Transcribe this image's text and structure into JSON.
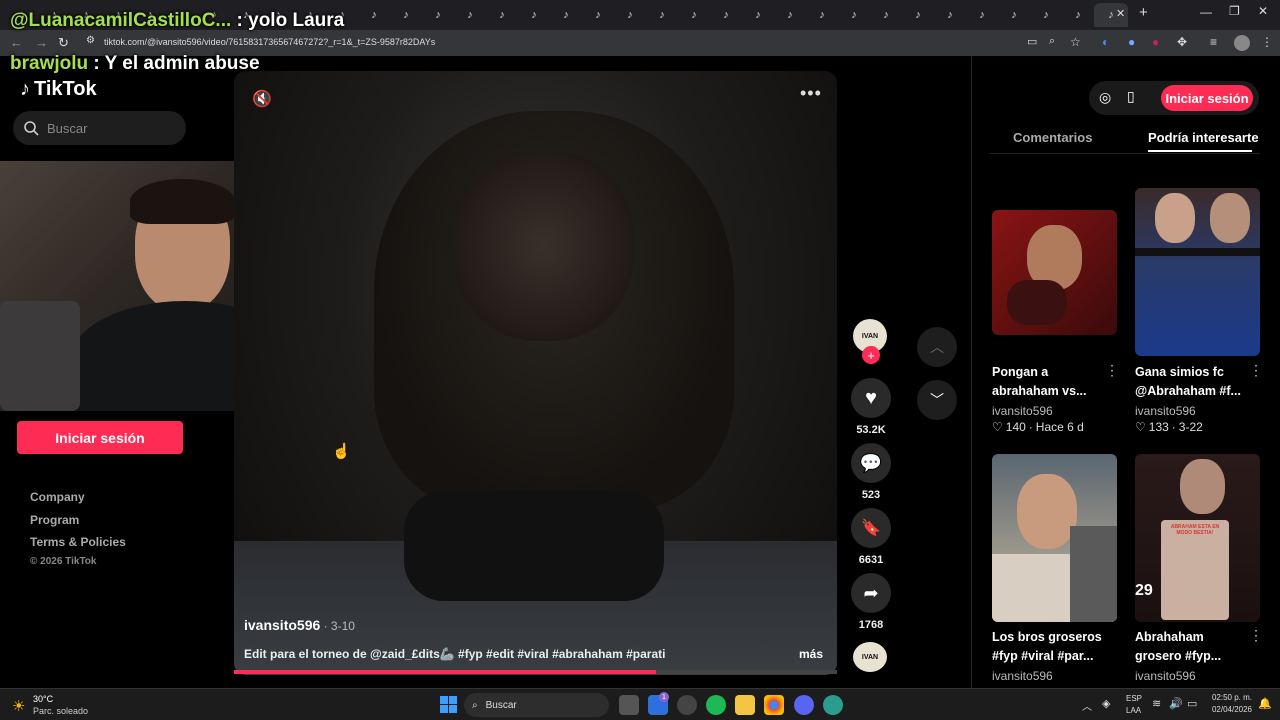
{
  "browser": {
    "url": "tiktok.com/@ivansito596/video/7615831736567467272?_r=1&_t=ZS-9587r82DAYs",
    "tab_close": "✕",
    "new_tab": "+"
  },
  "chat_overlay": [
    {
      "user": "@LuanacamilCastilloC...",
      "message": " : yolo Laura"
    },
    {
      "user": "brawjolu",
      "message": " : Y el admin abuse"
    }
  ],
  "sidebar": {
    "logo": "TikTok",
    "search_placeholder": "Buscar",
    "login_label": "Iniciar sesión",
    "footer": [
      "Company",
      "Program",
      "Terms & Policies"
    ],
    "copyright": "© 2026 TikTok"
  },
  "video": {
    "author": "ivansito596",
    "date": " · 3-10",
    "caption": "Edit para el torneo de @zaid_£dits🦾 #fyp #edit #viral #abrahaham #parati",
    "more": "más",
    "progress": 0.7
  },
  "actions": {
    "likes": "53.2K",
    "comments": "523",
    "saves": "6631",
    "shares": "1768"
  },
  "header": {
    "login_label": "Iniciar sesión"
  },
  "right_panel": {
    "tabs": [
      "Comentarios",
      "Podría interesarte"
    ],
    "cards": [
      {
        "title": "Pongan a abrahaham vs...",
        "author": "ivansito596",
        "likes": "140",
        "date": "Hace 6 d"
      },
      {
        "title": "Gana simios fc @Abrahaham #f...",
        "author": "ivansito596",
        "likes": "133",
        "date": "3-22"
      },
      {
        "title": "Los bros groseros #fyp #viral #par...",
        "author": "ivansito596"
      },
      {
        "title": "Abrahaham grosero #fyp...",
        "author": "ivansito596"
      }
    ],
    "thumb_texts": [
      "ABRAHAM ESTA EN MODO BESTIA!",
      "29"
    ]
  },
  "taskbar": {
    "weather_temp": "30°C",
    "weather_desc": "Parc. soleado",
    "search": "Buscar",
    "lang": "ESP",
    "lang2": "LAA",
    "time": "02:50 p. m.",
    "date": "02/04/2026",
    "badge": "1"
  },
  "colors": {
    "accent": "#fe2c55",
    "chat_user_green": "#a4e04d"
  }
}
